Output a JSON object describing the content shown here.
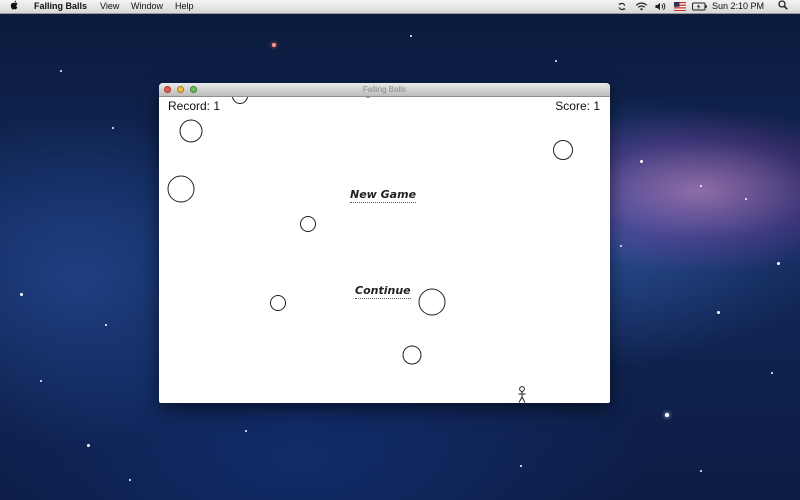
{
  "menubar": {
    "app_name": "Falling Balls",
    "menus": [
      "View",
      "Window",
      "Help"
    ],
    "clock": "Sun 2:10 PM",
    "tray_icons": [
      "sync-icon",
      "wifi-icon",
      "volume-icon",
      "us-flag-icon",
      "battery-icon"
    ]
  },
  "window": {
    "title": "Falling Balls"
  },
  "game": {
    "record_label": "Record: 1",
    "score_label": "Score: 1",
    "new_game_label": "New Game",
    "continue_label": "Continue"
  },
  "colors": {
    "ball_stroke": "#222222",
    "background_white": "#ffffff"
  }
}
